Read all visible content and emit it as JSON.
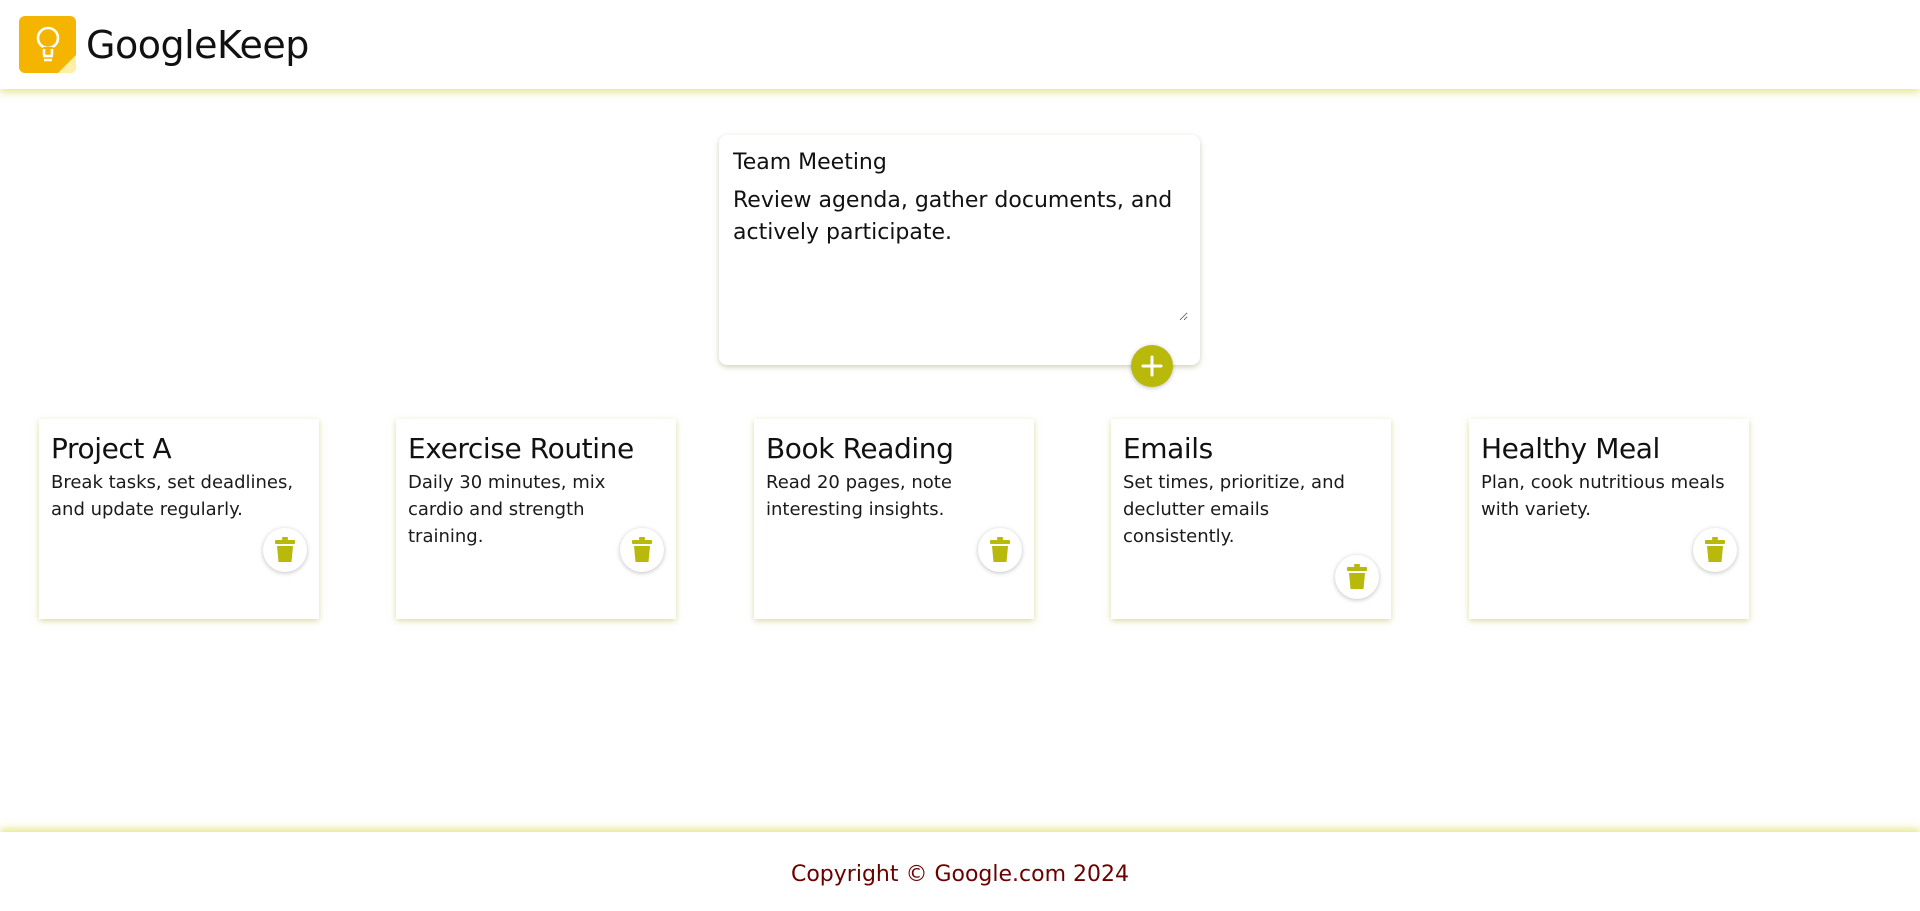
{
  "header": {
    "app_title": "GoogleKeep",
    "logo_icon": "keep-lightbulb-icon"
  },
  "composer": {
    "title_value": "Team Meeting",
    "body_value": "Review agenda, gather documents, and actively participate.",
    "add_icon": "plus-icon"
  },
  "notes": [
    {
      "title": "Project A",
      "text": "Break tasks, set deadlines, and update regularly.",
      "delete_icon": "trash-icon"
    },
    {
      "title": "Exercise Routine",
      "text": "Daily 30 minutes, mix cardio and strength training.",
      "delete_icon": "trash-icon"
    },
    {
      "title": "Book Reading",
      "text": "Read 20 pages, note interesting insights.",
      "delete_icon": "trash-icon"
    },
    {
      "title": "Emails",
      "text": "Set times, prioritize, and declutter emails consistently.",
      "delete_icon": "trash-icon"
    },
    {
      "title": "Healthy Meal",
      "text": "Plan, cook nutritious meals with variety.",
      "delete_icon": "trash-icon"
    }
  ],
  "footer": {
    "copyright": "Copyright © Google.com 2024"
  },
  "colors": {
    "accent": "#b9b90c",
    "logo": "#f5b400",
    "footer_text": "#6b0000"
  }
}
